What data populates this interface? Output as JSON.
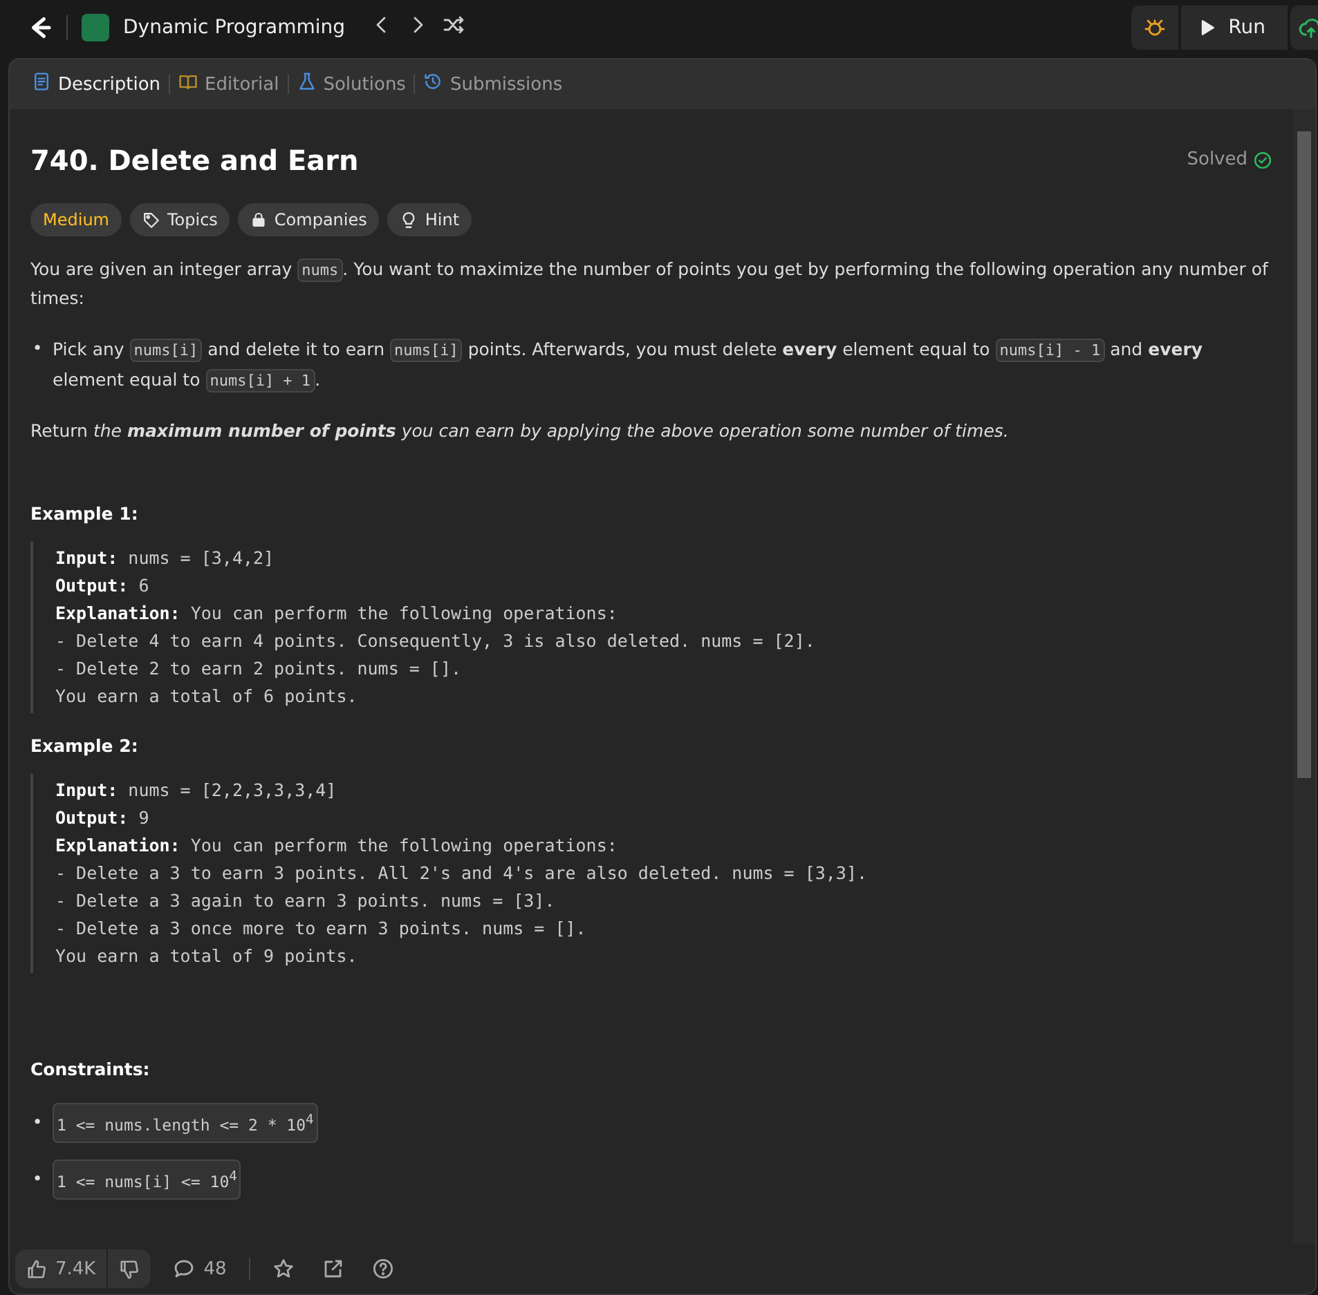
{
  "top_bar": {
    "list_title": "Dynamic Programming",
    "run_label": "Run"
  },
  "tabs": [
    {
      "label": "Description",
      "selected": true
    },
    {
      "label": "Editorial",
      "selected": false
    },
    {
      "label": "Solutions",
      "selected": false
    },
    {
      "label": "Submissions",
      "selected": false
    }
  ],
  "problem": {
    "title": "740. Delete and Earn",
    "status": "Solved",
    "solved": true,
    "tags": [
      {
        "kind": "difficulty",
        "label": "Medium"
      },
      {
        "kind": "topics",
        "label": "Topics"
      },
      {
        "kind": "companies",
        "label": "Companies"
      },
      {
        "kind": "hint",
        "label": "Hint"
      }
    ],
    "intro": [
      {
        "kind": "text",
        "text": "You are given an integer array "
      },
      {
        "kind": "code",
        "text": "nums"
      },
      {
        "kind": "text",
        "text": ". You want to maximize the number of points you get by performing the following operation any number of times:"
      }
    ],
    "bullets": [
      {
        "marker": "•",
        "segments": [
          {
            "kind": "text",
            "text": "Pick any "
          },
          {
            "kind": "code",
            "text": "nums[i]"
          },
          {
            "kind": "text",
            "text": " and delete it to earn "
          },
          {
            "kind": "code",
            "text": "nums[i]"
          },
          {
            "kind": "text",
            "text": " points. Afterwards, you must delete "
          },
          {
            "kind": "strong",
            "text": "every"
          },
          {
            "kind": "text",
            "text": " element equal to "
          },
          {
            "kind": "code",
            "text": "nums[i] - 1"
          },
          {
            "kind": "text",
            "text": " and "
          },
          {
            "kind": "strong",
            "text": "every"
          },
          {
            "kind": "text",
            "text": " element equal to "
          },
          {
            "kind": "code",
            "text": "nums[i] + 1"
          },
          {
            "kind": "text",
            "text": "."
          }
        ]
      }
    ],
    "task": [
      {
        "kind": "text",
        "text": "Return "
      },
      {
        "kind": "em",
        "text": "the "
      },
      {
        "kind": "strong_em",
        "text": "maximum number of points"
      },
      {
        "kind": "em",
        "text": " you can earn by applying the above operation some number of times."
      }
    ],
    "examples": [
      {
        "heading": "Example 1:",
        "lines": [
          {
            "label": "Input:",
            "text": " nums = [3,4,2]"
          },
          {
            "label": "Output:",
            "text": " 6"
          },
          {
            "label": "Explanation:",
            "text": " You can perform the following operations:"
          },
          {
            "text": "- Delete 4 to earn 4 points. Consequently, 3 is also deleted. nums = [2]."
          },
          {
            "text": "- Delete 2 to earn 2 points. nums = []."
          },
          {
            "text": "You earn a total of 6 points."
          }
        ]
      },
      {
        "heading": "Example 2:",
        "lines": [
          {
            "label": "Input:",
            "text": " nums = [2,2,3,3,3,4]"
          },
          {
            "label": "Output:",
            "text": " 9"
          },
          {
            "label": "Explanation:",
            "text": " You can perform the following operations:"
          },
          {
            "text": "- Delete a 3 to earn 3 points. All 2's and 4's are also deleted. nums = [3,3]."
          },
          {
            "text": "- Delete a 3 again to earn 3 points. nums = [3]."
          },
          {
            "text": "- Delete a 3 once more to earn 3 points. nums = []."
          },
          {
            "text": "You earn a total of 9 points."
          }
        ]
      }
    ],
    "constraints_heading": "Constraints:",
    "constraints": [
      {
        "marker": "•",
        "text": "1 <= nums.length <= 2 * 10$^{4}$"
      },
      {
        "marker": "•",
        "text": "1 <= nums[i] <= 10$^{4}$"
      }
    ]
  },
  "footer": {
    "likes": "7.4K",
    "comments": "48"
  }
}
